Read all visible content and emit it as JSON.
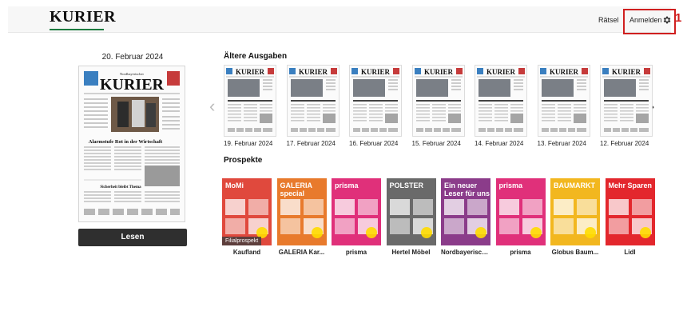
{
  "header": {
    "logo": "KURIER",
    "nav_raetsel": "Rätsel",
    "nav_anmelden": "Anmelden",
    "annotation_number": "1"
  },
  "current_issue": {
    "date": "20. Februar 2024",
    "masthead_small": "Nordbayerischer",
    "masthead": "KURIER",
    "headline": "Alarmstufe Rot in der Wirtschaft",
    "subheadline": "Sicherheit bleibt Thema",
    "read_button": "Lesen"
  },
  "older": {
    "title": "Ältere Ausgaben",
    "issues": [
      {
        "date": "19. Februar 2024",
        "masthead": "KURIER"
      },
      {
        "date": "17. Februar 2024",
        "masthead": "KURIER"
      },
      {
        "date": "16. Februar 2024",
        "masthead": "KURIER"
      },
      {
        "date": "15. Februar 2024",
        "masthead": "KURIER"
      },
      {
        "date": "14. Februar 2024",
        "masthead": "KURIER"
      },
      {
        "date": "13. Februar 2024",
        "masthead": "KURIER"
      },
      {
        "date": "12. Februar 2024",
        "masthead": "KURIER"
      }
    ]
  },
  "prospekte": {
    "title": "Prospekte",
    "items": [
      {
        "name": "Kaufland",
        "tag": "Filialprospekt",
        "cover_text": "MoMi",
        "color": "#e0493d"
      },
      {
        "name": "GALERIA Kar...",
        "tag": "",
        "cover_text": "GALERIA special",
        "color": "#e87a2c"
      },
      {
        "name": "prisma",
        "tag": "",
        "cover_text": "prisma",
        "color": "#e0307a"
      },
      {
        "name": "Hertel Möbel",
        "tag": "",
        "cover_text": "POLSTER",
        "color": "#6a6a6a"
      },
      {
        "name": "Nordbayerisch...",
        "tag": "",
        "cover_text": "Ein neuer Leser für uns",
        "color": "#8b3c8a"
      },
      {
        "name": "prisma",
        "tag": "",
        "cover_text": "prisma",
        "color": "#e0307a"
      },
      {
        "name": "Globus Baum...",
        "tag": "",
        "cover_text": "BAUMARKT",
        "color": "#f2b71f"
      },
      {
        "name": "Lidl",
        "tag": "",
        "cover_text": "Mehr Sparen",
        "color": "#e3272d"
      }
    ]
  }
}
